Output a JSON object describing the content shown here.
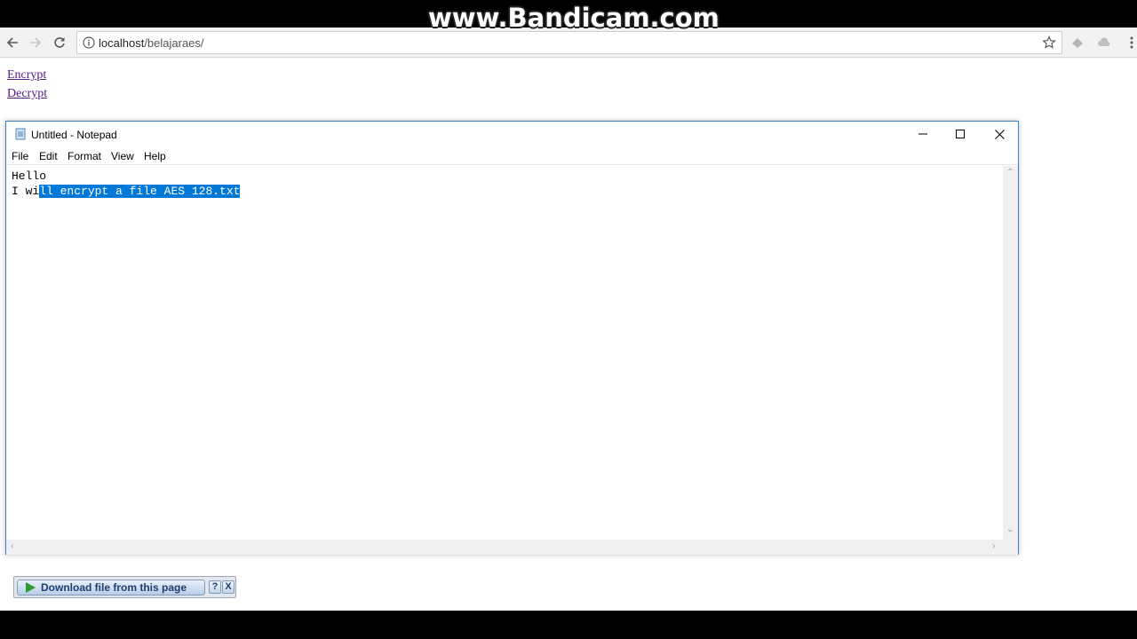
{
  "browser": {
    "url_host": "localhost",
    "url_path": "/belajaraes/"
  },
  "watermark": "www.Bandicam.com",
  "page": {
    "links": [
      "Encrypt",
      "Decrypt"
    ]
  },
  "notepad": {
    "title": "Untitled - Notepad",
    "menu": [
      "File",
      "Edit",
      "Format",
      "View",
      "Help"
    ],
    "line1": "Hello",
    "line2_unselected": "I wi",
    "line2_selected": "ll encrypt a file AES 128.txt"
  },
  "download_bar": {
    "label": "Download file from this page",
    "help": "?",
    "close": "X"
  },
  "colors": {
    "link_visited": "#551a8b",
    "selection": "#0078d7",
    "window_border": "#3c80c8"
  }
}
